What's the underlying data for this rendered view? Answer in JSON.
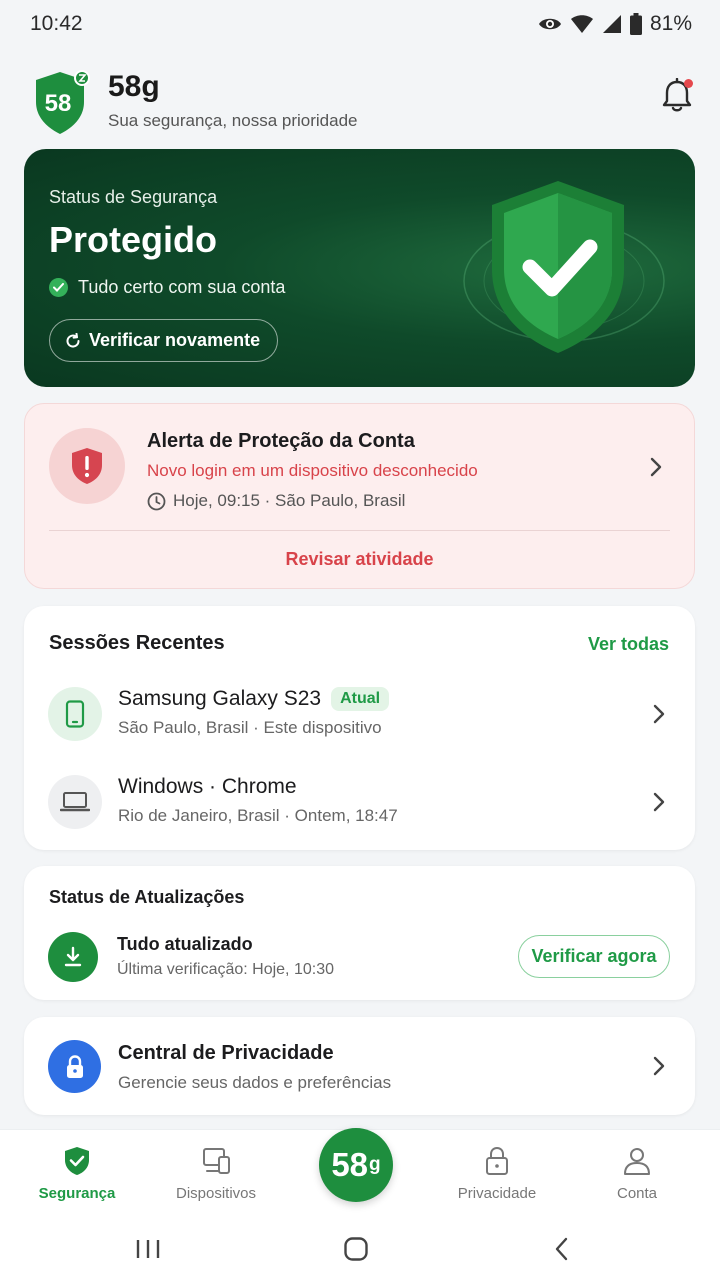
{
  "status_bar": {
    "time": "10:42",
    "battery": "81%"
  },
  "header": {
    "logo_text": "58",
    "app_name": "58g",
    "tagline": "Sua segurança, nossa prioridade",
    "has_notification": true
  },
  "hero": {
    "label": "Status de Segurança",
    "status": "Protegido",
    "subtitle": "Tudo certo com sua conta",
    "button": "Verificar novamente"
  },
  "alert": {
    "title": "Alerta de Proteção da Conta",
    "message": "Novo login em um dispositivo desconhecido",
    "time": "Hoje, 09:15 · São Paulo, Brasil",
    "action": "Revisar atividade"
  },
  "sessions": {
    "title": "Sessões Recentes",
    "see_all": "Ver todas",
    "items": [
      {
        "device": "Samsung Galaxy S23",
        "badge": "Atual",
        "meta": "São Paulo, Brasil · Este dispositivo",
        "icon": "phone-icon"
      },
      {
        "device": "Windows · Chrome",
        "badge": "",
        "meta": "Rio de Janeiro, Brasil · Ontem, 18:47",
        "icon": "laptop-icon"
      }
    ]
  },
  "updates": {
    "title": "Status de Atualizações",
    "status": "Tudo atualizado",
    "last_check": "Última verificação: Hoje, 10:30",
    "button": "Verificar agora"
  },
  "privacy": {
    "title": "Central de Privacidade",
    "subtitle": "Gerencie seus dados e preferências"
  },
  "bottom_nav": {
    "items": [
      {
        "label": "Segurança",
        "active": true
      },
      {
        "label": "Dispositivos",
        "active": false
      },
      {
        "label": "Privacidade",
        "active": false
      },
      {
        "label": "Conta",
        "active": false
      }
    ],
    "center": {
      "main": "58",
      "sub": "g"
    }
  },
  "colors": {
    "accent_green": "#1f9a46",
    "alert_red": "#d8434a",
    "hero_dark": "#0f4a2a",
    "privacy_blue": "#2f6fe3"
  }
}
